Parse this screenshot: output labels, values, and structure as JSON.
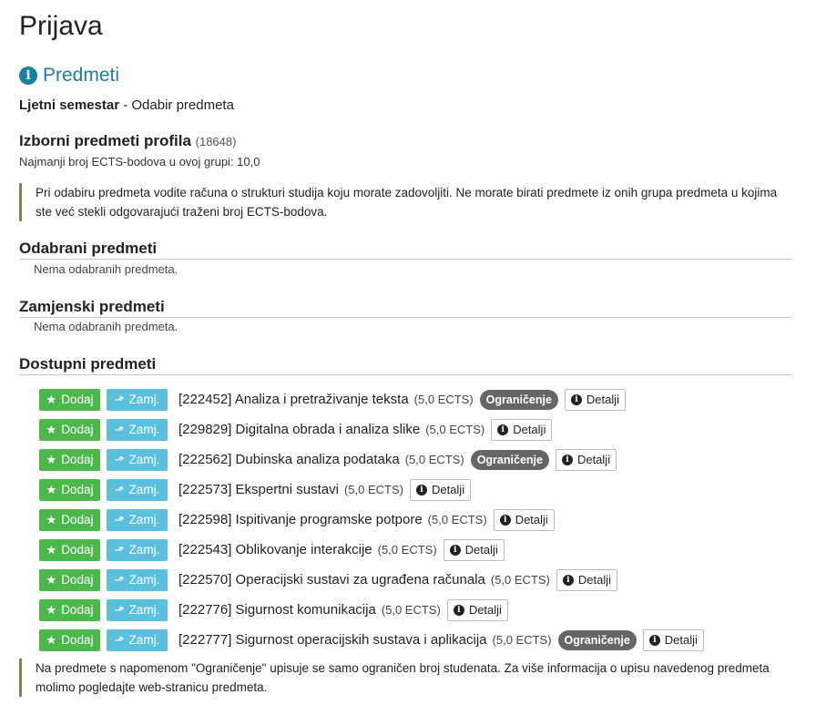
{
  "page": {
    "title": "Prijava",
    "section_title": "Predmeti",
    "semester_bold": "Ljetni semestar",
    "semester_rest": " - Odabir predmeta",
    "group_title": "Izborni predmeti profila",
    "group_code": "(18648)",
    "min_ects": "Najmanji broj ECTS-bodova u ovoj grupi: 10,0",
    "note_top": "Pri odabiru predmeta vodite računa o strukturi studija koju morate zadovoljiti. Ne morate birati predmete iz onih grupa predmeta u kojima ste već stekli odgovarajući traženi broj ECTS-bodova.",
    "selected_title": "Odabrani predmeti",
    "selected_empty": "Nema odabranih predmeta.",
    "replacement_title": "Zamjenski predmeti",
    "replacement_empty": "Nema odabranih predmeta.",
    "available_title": "Dostupni predmeti",
    "note_bottom": "Na predmete s napomenom \"Ograničenje\" upisuje se samo ograničen broj studenata. Za više informacija o upisu navedenog predmeta molimo pogledajte web-stranicu predmeta."
  },
  "labels": {
    "dodaj": "Dodaj",
    "zamj": "Zamj.",
    "detalji": "Detalji",
    "ogranicenje": "Ograničenje"
  },
  "icons": {
    "section": "info-icon",
    "dodaj": "star-icon",
    "zamj": "replace-icon",
    "detalji": "info-icon"
  },
  "colors": {
    "accent": "#1a7f9c",
    "dodaj": "#4cb84c",
    "zamj": "#5bc0de",
    "badge": "#666666",
    "note_border": "#8a7d4f"
  },
  "courses": [
    {
      "name": "[222452] Analiza i pretraživanje teksta",
      "ects": "(5,0 ECTS)",
      "restricted": true
    },
    {
      "name": "[229829] Digitalna obrada i analiza slike",
      "ects": "(5,0 ECTS)",
      "restricted": false
    },
    {
      "name": "[222562] Dubinska analiza podataka",
      "ects": "(5,0 ECTS)",
      "restricted": true
    },
    {
      "name": "[222573] Ekspertni sustavi",
      "ects": "(5,0 ECTS)",
      "restricted": false
    },
    {
      "name": "[222598] Ispitivanje programske potpore",
      "ects": "(5,0 ECTS)",
      "restricted": false
    },
    {
      "name": "[222543] Oblikovanje interakcije",
      "ects": "(5,0 ECTS)",
      "restricted": false
    },
    {
      "name": "[222570] Operacijski sustavi za ugrađena računala",
      "ects": "(5,0 ECTS)",
      "restricted": false
    },
    {
      "name": "[222776] Sigurnost komunikacija",
      "ects": "(5,0 ECTS)",
      "restricted": false
    },
    {
      "name": "[222777] Sigurnost operacijskih sustava i aplikacija",
      "ects": "(5,0 ECTS)",
      "restricted": true
    }
  ]
}
